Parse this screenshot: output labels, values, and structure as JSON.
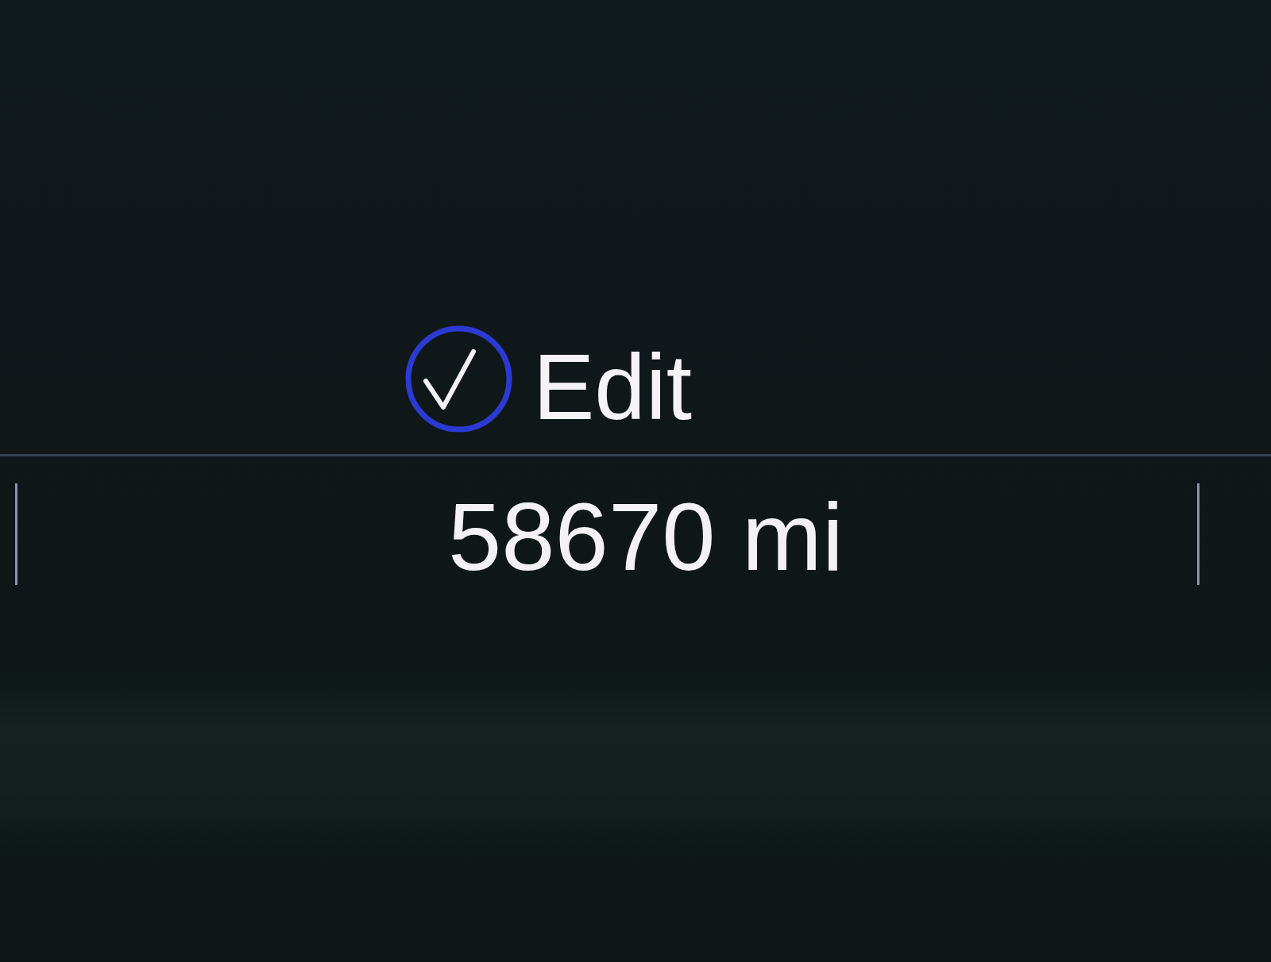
{
  "edit_button": {
    "label": "Edit"
  },
  "odometer": {
    "reading": "58670 mi"
  }
}
